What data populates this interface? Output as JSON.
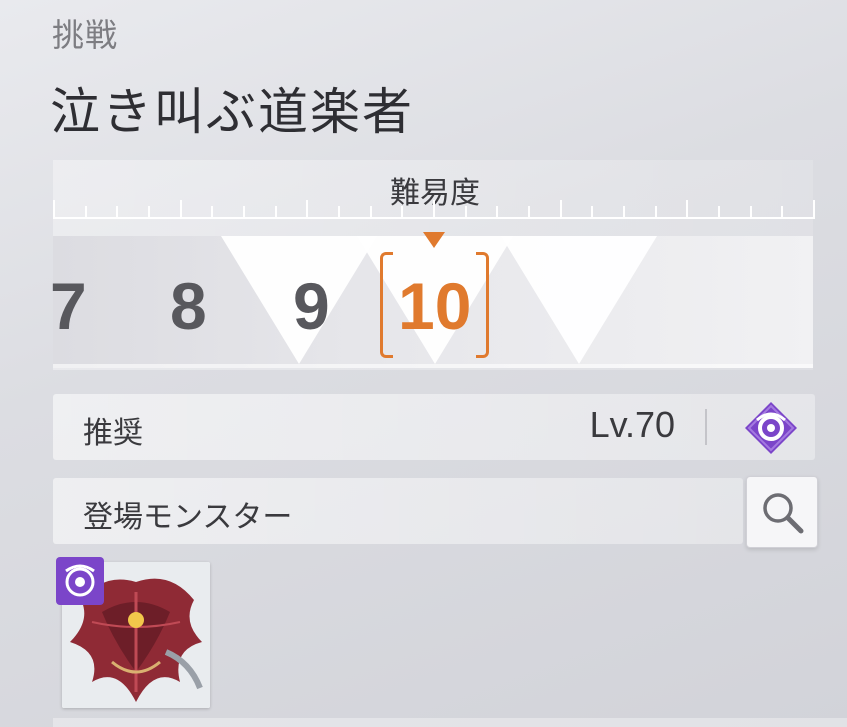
{
  "header": {
    "category": "挑戦",
    "title": "泣き叫ぶ道楽者"
  },
  "difficulty": {
    "label": "難易度",
    "levels": [
      "7",
      "8",
      "9",
      "10"
    ],
    "selected": "10"
  },
  "recommended": {
    "label": "推奨",
    "level": "Lv.70",
    "element_icon": "purple-diamond-element-icon",
    "element_color": "#7b45c9"
  },
  "monsters": {
    "label": "登場モンスター",
    "search_icon": "search-icon",
    "items": [
      {
        "name": "monster-thumbnail",
        "badge_icon": "purple-element-badge-icon"
      }
    ]
  },
  "colors": {
    "accent": "#e07a2e",
    "element_purple": "#7b45c9"
  }
}
